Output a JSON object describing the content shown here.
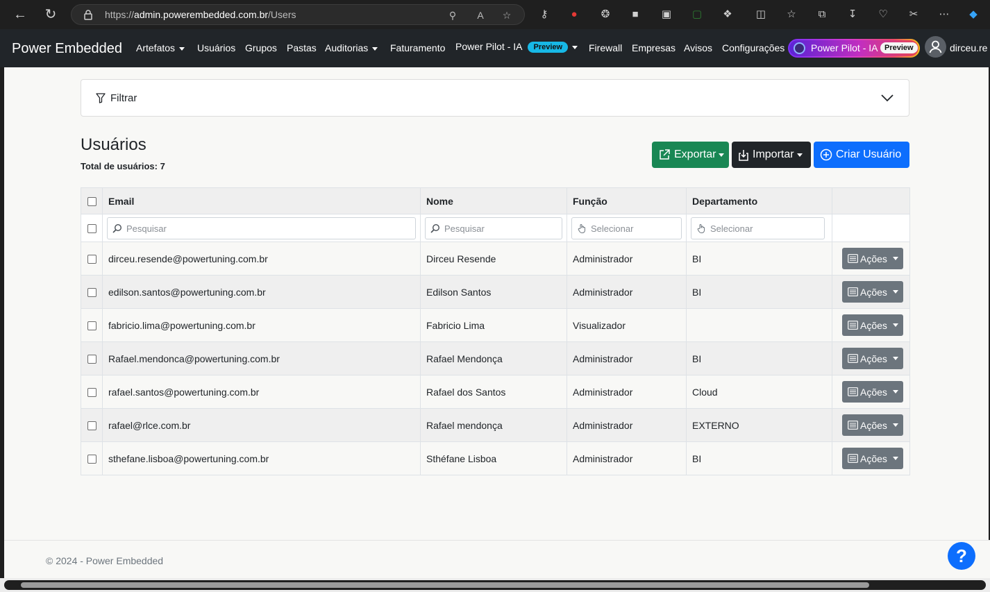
{
  "browser": {
    "url_prefix": "https://",
    "url_domain": "admin.powerembedded.com.br",
    "url_path": "/Users"
  },
  "navbar": {
    "brand": "Power Embedded",
    "items": [
      {
        "label": "Artefatos",
        "dropdown": true
      },
      {
        "label": "Usuários",
        "dropdown": false
      },
      {
        "label": "Grupos",
        "dropdown": false
      },
      {
        "label": "Pastas",
        "dropdown": false
      },
      {
        "label": "Auditorias",
        "dropdown": true
      },
      {
        "label": "Faturamento",
        "dropdown": false
      },
      {
        "label": "Power Pilot - IA",
        "dropdown": true,
        "badge": "Preview"
      },
      {
        "label": "Firewall",
        "dropdown": false
      },
      {
        "label": "Empresas",
        "dropdown": false
      },
      {
        "label": "Avisos",
        "dropdown": false
      },
      {
        "label": "Configurações",
        "dropdown": false
      }
    ],
    "power_pilot_pill": {
      "label": "Power Pilot - IA",
      "badge": "Preview"
    },
    "user": "dirceu.re"
  },
  "filter": {
    "label": "Filtrar"
  },
  "page": {
    "title": "Usuários",
    "total_label": "Total de usuários: 7"
  },
  "actions": {
    "export": "Exportar",
    "import": "Importar",
    "create": "Criar Usuário"
  },
  "table": {
    "headers": {
      "email": "Email",
      "name": "Nome",
      "role": "Função",
      "department": "Departamento"
    },
    "filters": {
      "email": "Pesquisar",
      "name": "Pesquisar",
      "role": "Selecionar",
      "department": "Selecionar"
    },
    "action_label": "Ações",
    "rows": [
      {
        "email": "dirceu.resende@powertuning.com.br",
        "name": "Dirceu Resende",
        "role": "Administrador",
        "department": "BI"
      },
      {
        "email": "edilson.santos@powertuning.com.br",
        "name": "Edilson Santos",
        "role": "Administrador",
        "department": "BI"
      },
      {
        "email": "fabricio.lima@powertuning.com.br",
        "name": "Fabricio Lima",
        "role": "Visualizador",
        "department": ""
      },
      {
        "email": "Rafael.mendonca@powertuning.com.br",
        "name": "Rafael Mendonça",
        "role": "Administrador",
        "department": "BI"
      },
      {
        "email": "rafael.santos@powertuning.com.br",
        "name": "Rafael dos Santos",
        "role": "Administrador",
        "department": "Cloud"
      },
      {
        "email": "rafael@rlce.com.br",
        "name": "Rafael mendonça",
        "role": "Administrador",
        "department": "EXTERNO"
      },
      {
        "email": "sthefane.lisboa@powertuning.com.br",
        "name": "Sthéfane Lisboa",
        "role": "Administrador",
        "department": "BI"
      }
    ]
  },
  "footer": {
    "text": "© 2024 - Power Embedded"
  },
  "help": {
    "label": "?"
  },
  "colors": {
    "navbar": "#212529",
    "export": "#198754",
    "import": "#212529",
    "create": "#0d6efd",
    "acoes": "#6c757d",
    "preview_badge": "#17b8e6"
  }
}
